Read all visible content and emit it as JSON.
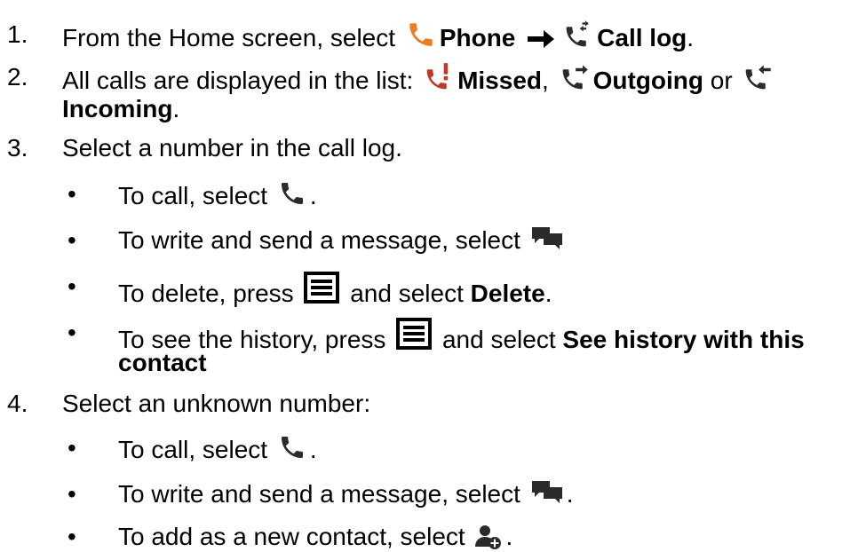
{
  "steps": [
    {
      "number": "1.",
      "prefix": "From the Home screen, select ",
      "phone": "Phone",
      "call_log": "Call log",
      "end": "."
    },
    {
      "number": "2.",
      "prefix": "All calls are displayed in the list: ",
      "missed": "Missed",
      "comma": ",",
      "outgoing": "Outgoing",
      "or": " or ",
      "incoming": "Incoming",
      "end": "."
    },
    {
      "number": "3.",
      "text": "Select a number in the call log.",
      "bullets": [
        {
          "prefix": "To call, select ",
          "end": "."
        },
        {
          "prefix": "To write and send a message, select "
        },
        {
          "prefix": "To delete, press ",
          "mid": " and select ",
          "bold": "Delete",
          "end": "."
        },
        {
          "prefix": "To see the history, press ",
          "mid": " and select ",
          "bold_line1": "See history with this",
          "bold_line2": "contact"
        }
      ]
    },
    {
      "number": "4.",
      "text": "Select an unknown number:",
      "bullets": [
        {
          "prefix": "To call, select ",
          "end": "."
        },
        {
          "prefix": "To write and send a message, select ",
          "end": "."
        },
        {
          "prefix": "To add as a new contact, select ",
          "end": "."
        }
      ]
    }
  ],
  "bullet_char": "•",
  "icons": {
    "phone": "phone-icon",
    "arrow": "right-arrow-icon",
    "call_log": "call-log-icon",
    "missed": "missed-call-icon",
    "outgoing": "outgoing-call-icon",
    "incoming": "incoming-call-icon",
    "call": "call-icon",
    "message": "message-icon",
    "menu": "menu-icon",
    "add_contact": "add-contact-icon"
  },
  "colors": {
    "text": "#000000",
    "phone_orange": "#f07c22",
    "missed_red": "#c0392b",
    "icon_dark": "#2b2b2b"
  }
}
